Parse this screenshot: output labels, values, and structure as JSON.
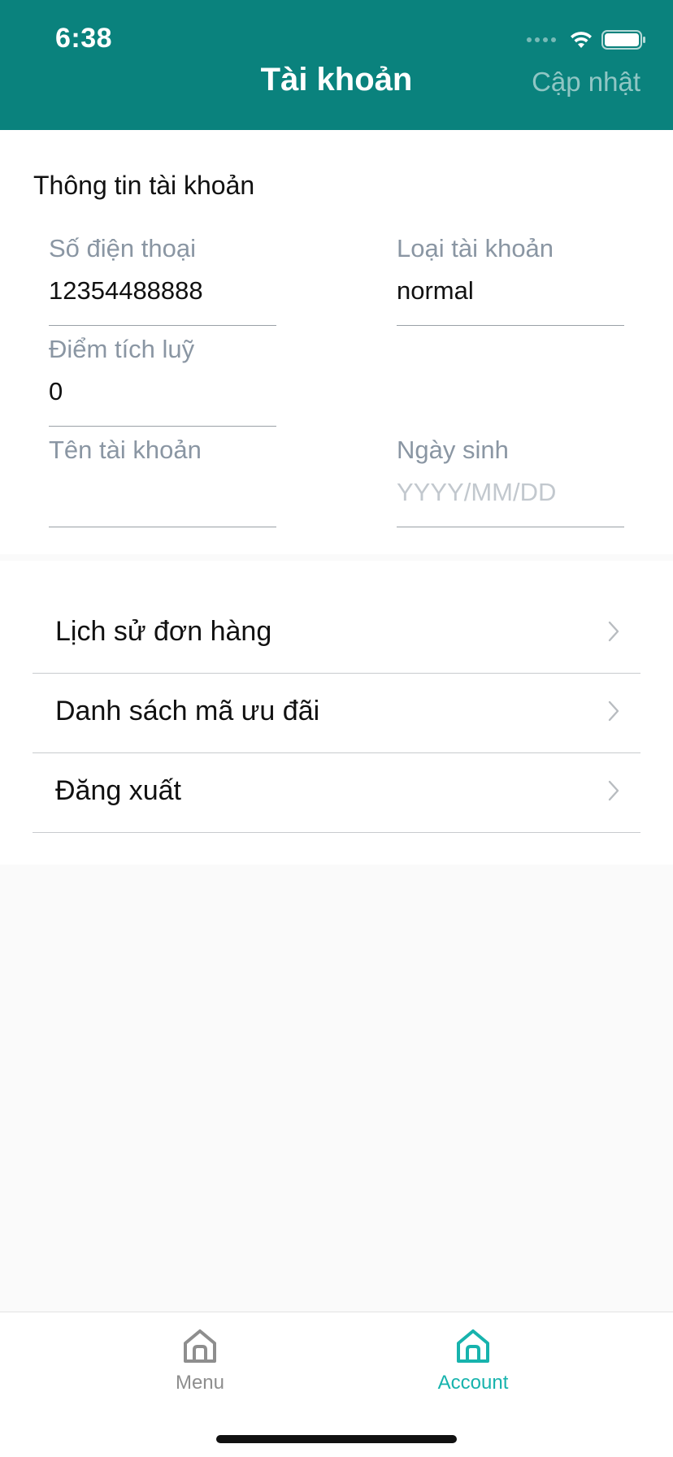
{
  "status_bar": {
    "time": "6:38"
  },
  "header": {
    "title": "Tài khoản",
    "action_label": "Cập nhật"
  },
  "account_info": {
    "section_title": "Thông tin tài khoản",
    "phone": {
      "label": "Số điện thoại",
      "value": "12354488888"
    },
    "account_type": {
      "label": "Loại tài khoản",
      "value": "normal"
    },
    "points": {
      "label": "Điểm tích luỹ",
      "value": "0"
    },
    "account_name": {
      "label": "Tên tài khoản",
      "value": ""
    },
    "birthday": {
      "label": "Ngày sinh",
      "placeholder": "YYYY/MM/DD"
    }
  },
  "menu": {
    "items": [
      {
        "label": "Lịch sử đơn hàng"
      },
      {
        "label": "Danh sách mã ưu đãi"
      },
      {
        "label": "Đăng xuất"
      }
    ]
  },
  "tabbar": {
    "tabs": [
      {
        "label": "Menu",
        "icon": "home-icon",
        "active": false
      },
      {
        "label": "Account",
        "icon": "home-icon",
        "active": true
      }
    ]
  },
  "colors": {
    "header_bg": "#0a827d",
    "accent": "#17b3ad",
    "inactive_tab": "#8e8e8e"
  }
}
